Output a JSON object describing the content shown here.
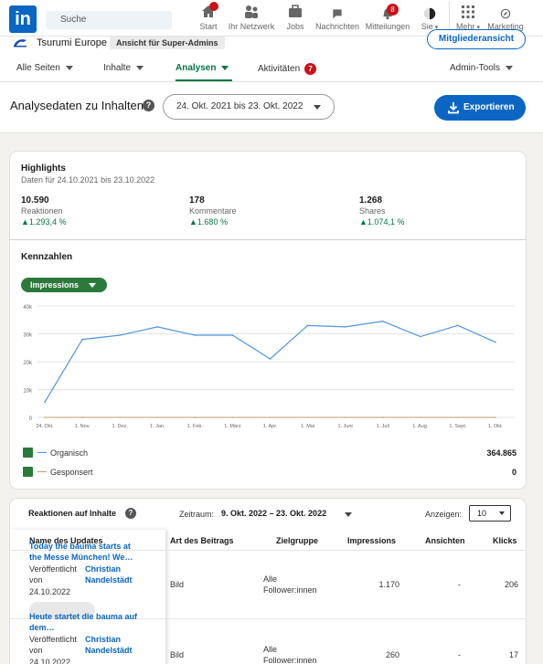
{
  "nav": {
    "logo": "in",
    "search_placeholder": "Suche",
    "items": [
      {
        "label": "Start",
        "icon": "home-icon"
      },
      {
        "label": "Ihr Netzwerk",
        "icon": "network-icon"
      },
      {
        "label": "Jobs",
        "icon": "briefcase-icon"
      },
      {
        "label": "Nachrichten",
        "icon": "messaging-icon"
      },
      {
        "label": "Mitteilungen",
        "icon": "bell-icon",
        "badge": "8"
      },
      {
        "label": "Sie",
        "icon": "avatar-icon"
      },
      {
        "label": "Mehr",
        "icon": "grid-icon"
      },
      {
        "label": "Marketing",
        "icon": "compass-icon"
      }
    ]
  },
  "company": {
    "name": "Tsurumi Europe",
    "admin_badge": "Ansicht für Super-Admins",
    "members_button": "Mitgliederansicht"
  },
  "tabs": [
    {
      "label": "Alle Seiten"
    },
    {
      "label": "Inhalte"
    },
    {
      "label": "Analysen"
    },
    {
      "label": "Aktivitäten",
      "badge": "7"
    },
    {
      "label": "Admin-Tools"
    }
  ],
  "header": {
    "title": "Analysedaten zu Inhalten",
    "date_range": "24. Okt. 2021 bis 23. Okt. 2022",
    "export_label": "Exportieren"
  },
  "highlights": {
    "title": "Highlights",
    "subtitle": "Daten für 24.10.2021 bis 23.10.2022",
    "metrics": [
      {
        "value": "10.590",
        "label": "Reaktionen",
        "change": "1.293,4 %"
      },
      {
        "value": "178",
        "label": "Kommentare",
        "change": "1.680 %"
      },
      {
        "value": "1.268",
        "label": "Shares",
        "change": "1.074,1 %"
      }
    ]
  },
  "kennzahlen": {
    "title": "Kennzahlen",
    "metric_selector": "Impressions",
    "legend": [
      {
        "name": "Organisch",
        "value": "364.865"
      },
      {
        "name": "Gesponsert",
        "value": "0"
      }
    ]
  },
  "chart_data": {
    "type": "line",
    "x": [
      "24. Okt.",
      "1. Nov.",
      "1. Dez.",
      "1. Jan.",
      "1. Feb.",
      "1. März",
      "1. Apr.",
      "1. Mai",
      "1. Juni",
      "1. Juli",
      "1. Aug.",
      "1. Sept.",
      "1. Okt."
    ],
    "series": [
      {
        "name": "Organisch",
        "color": "#4f95dd",
        "values": [
          5500,
          28000,
          29500,
          32500,
          29500,
          29500,
          21000,
          33000,
          32500,
          34500,
          29000,
          33000,
          27000
        ]
      },
      {
        "name": "Gesponsert",
        "color": "#b5a06a",
        "values": [
          0,
          0,
          0,
          0,
          0,
          0,
          0,
          0,
          0,
          0,
          0,
          0,
          0
        ]
      }
    ],
    "yticks": [
      "0",
      "10k",
      "20k",
      "30k",
      "40k"
    ],
    "ylim": [
      0,
      40000
    ],
    "grid": true
  },
  "table": {
    "title": "Reaktionen auf Inhalte",
    "period_label": "Zeitraum:",
    "period_value": "9. Okt. 2022 – 23. Okt. 2022",
    "show_label": "Anzeigen:",
    "show_value": "10",
    "columns": [
      "Name des Updates",
      "Art des Beitrags",
      "Zielgruppe",
      "Impressions",
      "Ansichten",
      "Klicks"
    ],
    "rows": [
      {
        "title": "Today the bauma starts at the Messe München! We…",
        "published": "Veröffentlicht von",
        "author": "Christian Nandelstädt",
        "date": "24.10.2022",
        "type": "Bild",
        "audience": "Alle Follower:innen",
        "impressions": "1.170",
        "views": "-",
        "clicks": "206"
      },
      {
        "title": "Heute startet die bauma auf dem…",
        "published": "Veröffentlicht von",
        "author": "Christian Nandelstädt",
        "date": "24.10.2022",
        "type": "Bild",
        "audience": "Alle Follower:innen",
        "impressions": "260",
        "views": "-",
        "clicks": "17"
      }
    ]
  }
}
